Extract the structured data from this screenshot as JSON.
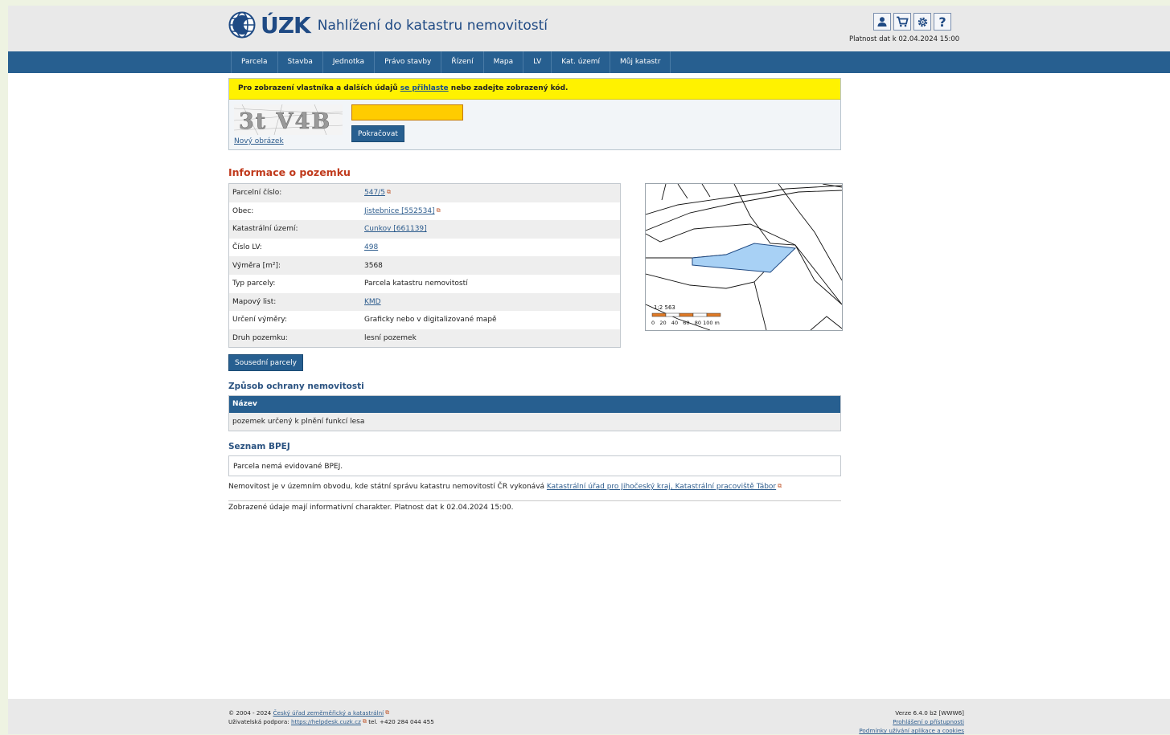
{
  "header": {
    "logo_text": "ÚZK",
    "app_title": "Nahlížení do katastru nemovitostí",
    "validity": "Platnost dat k 02.04.2024 15:00",
    "icons": [
      "user-icon",
      "cart-icon",
      "settings-icon",
      "help-icon"
    ]
  },
  "nav": {
    "items": [
      "Parcela",
      "Stavba",
      "Jednotka",
      "Právo stavby",
      "Řízení",
      "Mapa",
      "LV",
      "Kat. území",
      "Můj katastr"
    ]
  },
  "login": {
    "msg_before": "Pro zobrazení vlastníka a dalších údajů",
    "msg_link": "se přihlaste",
    "msg_after": "nebo zadejte zobrazený kód.",
    "captcha_text": "3t V4B",
    "new_image": "Nový obrázek",
    "continue_label": "Pokračovat",
    "input_value": ""
  },
  "parcel": {
    "heading": "Informace o pozemku",
    "rows": [
      {
        "label": "Parcelní číslo:",
        "value": "547/5",
        "link": true,
        "ext": true
      },
      {
        "label": "Obec:",
        "value": "Jistebnice [552534]",
        "link": true,
        "ext": true
      },
      {
        "label": "Katastrální území:",
        "value": "Cunkov [661139]",
        "link": true,
        "ext": false
      },
      {
        "label": "Číslo LV:",
        "value": "498",
        "link": true,
        "ext": false
      },
      {
        "label": "Výměra [m²]:",
        "value": "3568",
        "link": false,
        "ext": false
      },
      {
        "label": "Typ parcely:",
        "value": "Parcela katastru nemovitostí",
        "link": false,
        "ext": false
      },
      {
        "label": "Mapový list:",
        "value": "KMD",
        "link": true,
        "ext": false
      },
      {
        "label": "Určení výměry:",
        "value": "Graficky nebo v digitalizované mapě",
        "link": false,
        "ext": false
      },
      {
        "label": "Druh pozemku:",
        "value": "lesní pozemek",
        "link": false,
        "ext": false
      }
    ],
    "neighbor_button": "Sousední parcely"
  },
  "map": {
    "scale": "1:2 563",
    "scale_ticks": "0   20   40   60   80 100 m",
    "parcel_color": "#a8d1f5"
  },
  "protection": {
    "heading": "Způsob ochrany nemovitosti",
    "column": "Název",
    "value": "pozemek určený k plnění funkcí lesa"
  },
  "bpej": {
    "heading": "Seznam BPEJ",
    "value": "Parcela nemá evidované BPEJ."
  },
  "territory": {
    "text": "Nemovitost je v územním obvodu, kde státní správu katastru nemovitostí ČR vykonává",
    "link": "Katastrální úřad pro Jihočeský kraj, Katastrální pracoviště Tábor"
  },
  "disclaimer": "Zobrazené údaje mají informativní charakter. Platnost dat k 02.04.2024 15:00.",
  "footer": {
    "copyright": "© 2004 - 2024",
    "office_link": "Český úřad zeměměřický a katastrální",
    "support_label": "Uživatelská podpora:",
    "support_link": "https://helpdesk.cuzk.cz",
    "phone": "tel. +420 284 044 455",
    "version": "Verze 6.4.0 b2 [WWW6]",
    "accessibility": "Prohlášení o přístupnosti",
    "terms": "Podmínky užívání aplikace a cookies"
  },
  "colors": {
    "nav": "#275f90",
    "warning": "#fff200",
    "heading_red": "#c0391b",
    "heading_blue": "#2b5381"
  }
}
